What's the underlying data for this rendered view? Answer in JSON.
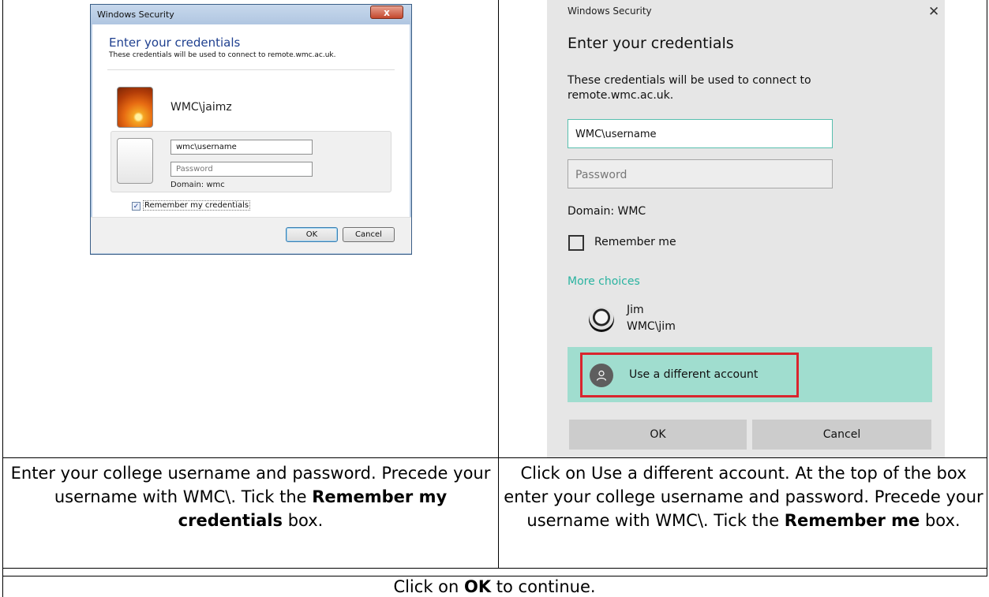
{
  "win7_dialog": {
    "title": "Windows Security",
    "close_glyph": "x",
    "heading": "Enter your credentials",
    "subtext": "These credentials will be used to connect to remote.wmc.ac.uk.",
    "saved_user": "WMC\\jaimz",
    "username_value": "wmc\\username",
    "password_placeholder": "Password",
    "domain": "Domain: wmc",
    "remember_label": "Remember my credentials",
    "remember_checked": true,
    "ok_label": "OK",
    "cancel_label": "Cancel"
  },
  "win10_dialog": {
    "title": "Windows Security",
    "close_glyph": "✕",
    "heading": "Enter your credentials",
    "subtext": "These credentials will be used to connect to remote.wmc.ac.uk.",
    "username_value": "WMC\\username",
    "password_placeholder": "Password",
    "domain": "Domain: WMC",
    "remember_label": "Remember me",
    "remember_checked": false,
    "more_choices": "More choices",
    "account_name": "Jim",
    "account_id": "WMC\\jim",
    "different_account": "Use a different account",
    "ok_label": "OK",
    "cancel_label": "Cancel",
    "accent_color": "#2ab3a0",
    "highlight_color": "#d9252e"
  },
  "instructions": {
    "left": {
      "text1": "Enter your college username and password. Precede your username with WMC\\.  Tick the ",
      "bold": "Remember my credentials",
      "text2": " box."
    },
    "right": {
      "text1": "Click on Use a different account.  At the top of the box enter your college username and password.  Precede your username with WMC\\.  Tick the ",
      "bold": "Remember me",
      "text2": " box."
    },
    "bottom": {
      "text1": "Click on ",
      "bold": "OK",
      "text2": " to continue."
    }
  }
}
